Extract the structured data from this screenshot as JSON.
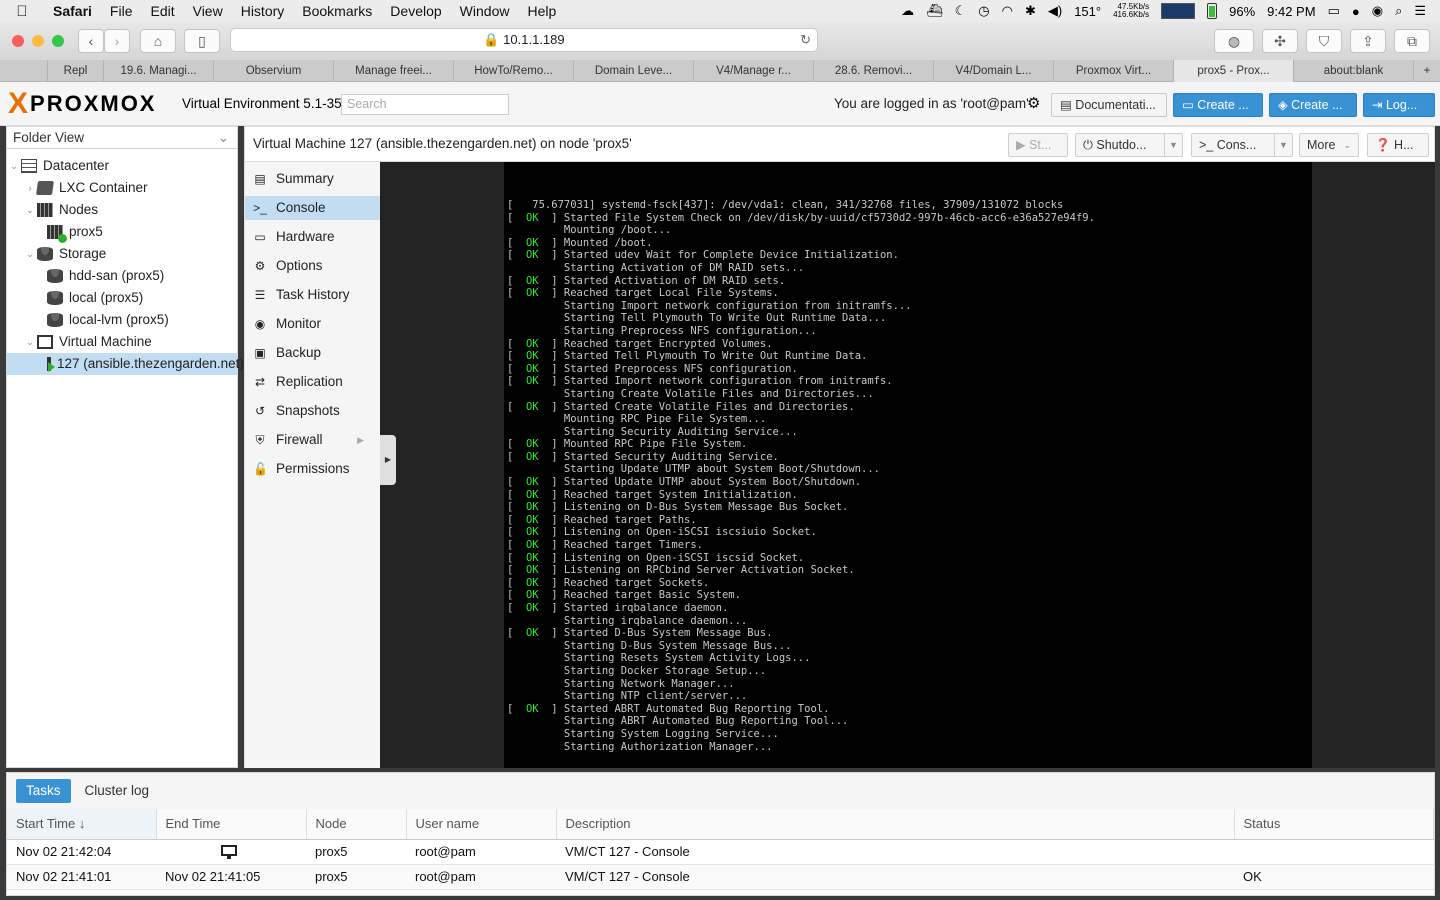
{
  "menubar": {
    "apple": "",
    "app_name": "Safari",
    "items": [
      "File",
      "Edit",
      "View",
      "History",
      "Bookmarks",
      "Develop",
      "Window",
      "Help"
    ],
    "temp": "151°",
    "net_up": "47.5Kb/s",
    "net_down": "416.6Kb/s",
    "battery": "96%",
    "clock": "9:42 PM"
  },
  "browser": {
    "url": "10.1.1.189",
    "tabs": [
      {
        "label": "Repl",
        "active": false
      },
      {
        "label": "19.6. Managi...",
        "active": false
      },
      {
        "label": "Observium",
        "active": false
      },
      {
        "label": "Manage freei...",
        "active": false
      },
      {
        "label": "HowTo/Remo...",
        "active": false
      },
      {
        "label": "Domain Leve...",
        "active": false
      },
      {
        "label": "V4/Manage r...",
        "active": false
      },
      {
        "label": "28.6. Removi...",
        "active": false
      },
      {
        "label": "V4/Domain L...",
        "active": false
      },
      {
        "label": "Proxmox Virt...",
        "active": false
      },
      {
        "label": "prox5 - Prox...",
        "active": true
      },
      {
        "label": "about:blank",
        "active": false
      }
    ],
    "new_tab": "+"
  },
  "pve": {
    "logo_x": "X",
    "logo_word": "PROXMOX",
    "version": "Virtual Environment 5.1-35",
    "search_placeholder": "Search",
    "logged_in": "You are logged in as 'root@pam'",
    "buttons": {
      "documentation": "Documentati...",
      "create_vm": "Create ...",
      "create_ct": "Create ...",
      "logout": "Log..."
    }
  },
  "tree": {
    "view_select": "Folder View",
    "nodes": [
      {
        "label": "Datacenter",
        "icon": "datacenter-icon"
      },
      {
        "label": "LXC Container",
        "icon": "container-icon"
      },
      {
        "label": "Nodes",
        "icon": "nodes-icon"
      },
      {
        "label": "prox5",
        "icon": "node-online-icon"
      },
      {
        "label": "Storage",
        "icon": "storage-icon"
      },
      {
        "label": "hdd-san (prox5)",
        "icon": "disk-icon"
      },
      {
        "label": "local (prox5)",
        "icon": "disk-icon"
      },
      {
        "label": "local-lvm (prox5)",
        "icon": "disk-icon"
      },
      {
        "label": "Virtual Machine",
        "icon": "vm-folder-icon"
      },
      {
        "label": "127 (ansible.thezengarden.net)",
        "icon": "vm-running-icon"
      }
    ]
  },
  "content": {
    "title": "Virtual Machine 127 (ansible.thezengarden.net) on node 'prox5'",
    "buttons": {
      "start": "St...",
      "shutdown": "Shutdo...",
      "console": "Cons...",
      "more": "More",
      "help": "H..."
    }
  },
  "vmnav": [
    {
      "label": "Summary",
      "icon": "summary-icon",
      "glyph": "▤"
    },
    {
      "label": "Console",
      "icon": "console-icon",
      "glyph": ">_"
    },
    {
      "label": "Hardware",
      "icon": "hardware-icon",
      "glyph": "▭"
    },
    {
      "label": "Options",
      "icon": "options-icon",
      "glyph": "⚙"
    },
    {
      "label": "Task History",
      "icon": "task-history-icon",
      "glyph": "☰"
    },
    {
      "label": "Monitor",
      "icon": "monitor-icon",
      "glyph": "◉"
    },
    {
      "label": "Backup",
      "icon": "backup-icon",
      "glyph": "▣"
    },
    {
      "label": "Replication",
      "icon": "replication-icon",
      "glyph": "⇄"
    },
    {
      "label": "Snapshots",
      "icon": "snapshots-icon",
      "glyph": "↺"
    },
    {
      "label": "Firewall",
      "icon": "firewall-icon",
      "glyph": "⛨"
    },
    {
      "label": "Permissions",
      "icon": "permissions-icon",
      "glyph": "🔓"
    }
  ],
  "console_lines": [
    {
      "ok": false,
      "text": "[   75.677031] systemd-fsck[437]: /dev/vda1: clean, 341/32768 files, 37909/131072 blocks"
    },
    {
      "ok": true,
      "text": "Started File System Check on /dev/disk/by-uuid/cf5730d2-997b-46cb-acc6-e36a527e94f9."
    },
    {
      "ok": false,
      "text": "         Mounting /boot..."
    },
    {
      "ok": true,
      "text": "Mounted /boot."
    },
    {
      "ok": true,
      "text": "Started udev Wait for Complete Device Initialization."
    },
    {
      "ok": false,
      "text": "         Starting Activation of DM RAID sets..."
    },
    {
      "ok": true,
      "text": "Started Activation of DM RAID sets."
    },
    {
      "ok": true,
      "text": "Reached target Local File Systems."
    },
    {
      "ok": false,
      "text": "         Starting Import network configuration from initramfs..."
    },
    {
      "ok": false,
      "text": "         Starting Tell Plymouth To Write Out Runtime Data..."
    },
    {
      "ok": false,
      "text": "         Starting Preprocess NFS configuration..."
    },
    {
      "ok": true,
      "text": "Reached target Encrypted Volumes."
    },
    {
      "ok": true,
      "text": "Started Tell Plymouth To Write Out Runtime Data."
    },
    {
      "ok": true,
      "text": "Started Preprocess NFS configuration."
    },
    {
      "ok": true,
      "text": "Started Import network configuration from initramfs."
    },
    {
      "ok": false,
      "text": "         Starting Create Volatile Files and Directories..."
    },
    {
      "ok": true,
      "text": "Started Create Volatile Files and Directories."
    },
    {
      "ok": false,
      "text": "         Mounting RPC Pipe File System..."
    },
    {
      "ok": false,
      "text": "         Starting Security Auditing Service..."
    },
    {
      "ok": true,
      "text": "Mounted RPC Pipe File System."
    },
    {
      "ok": true,
      "text": "Started Security Auditing Service."
    },
    {
      "ok": false,
      "text": "         Starting Update UTMP about System Boot/Shutdown..."
    },
    {
      "ok": true,
      "text": "Started Update UTMP about System Boot/Shutdown."
    },
    {
      "ok": true,
      "text": "Reached target System Initialization."
    },
    {
      "ok": true,
      "text": "Listening on D-Bus System Message Bus Socket."
    },
    {
      "ok": true,
      "text": "Reached target Paths."
    },
    {
      "ok": true,
      "text": "Listening on Open-iSCSI iscsiuio Socket."
    },
    {
      "ok": true,
      "text": "Reached target Timers."
    },
    {
      "ok": true,
      "text": "Listening on Open-iSCSI iscsid Socket."
    },
    {
      "ok": true,
      "text": "Listening on RPCbind Server Activation Socket."
    },
    {
      "ok": true,
      "text": "Reached target Sockets."
    },
    {
      "ok": true,
      "text": "Reached target Basic System."
    },
    {
      "ok": true,
      "text": "Started irqbalance daemon."
    },
    {
      "ok": false,
      "text": "         Starting irqbalance daemon..."
    },
    {
      "ok": true,
      "text": "Started D-Bus System Message Bus."
    },
    {
      "ok": false,
      "text": "         Starting D-Bus System Message Bus..."
    },
    {
      "ok": false,
      "text": "         Starting Resets System Activity Logs..."
    },
    {
      "ok": false,
      "text": "         Starting Docker Storage Setup..."
    },
    {
      "ok": false,
      "text": "         Starting Network Manager..."
    },
    {
      "ok": false,
      "text": "         Starting NTP client/server..."
    },
    {
      "ok": true,
      "text": "Started ABRT Automated Bug Reporting Tool."
    },
    {
      "ok": false,
      "text": "         Starting ABRT Automated Bug Reporting Tool..."
    },
    {
      "ok": false,
      "text": "         Starting System Logging Service..."
    },
    {
      "ok": false,
      "text": "         Starting Authorization Manager..."
    }
  ],
  "tasks": {
    "tabs": [
      "Tasks",
      "Cluster log"
    ],
    "columns": [
      "Start Time ↓",
      "End Time",
      "Node",
      "User name",
      "Description",
      "Status"
    ],
    "rows": [
      {
        "start": "Nov 02 21:42:04",
        "end": "",
        "end_icon": "monitor-icon",
        "node": "prox5",
        "user": "root@pam",
        "desc": "VM/CT 127 - Console",
        "status": ""
      },
      {
        "start": "Nov 02 21:41:01",
        "end": "Nov 02 21:41:05",
        "end_icon": "",
        "node": "prox5",
        "user": "root@pam",
        "desc": "VM/CT 127 - Console",
        "status": "OK"
      }
    ]
  },
  "colors": {
    "accent_blue": "#3892d4",
    "proxmox_orange": "#e57000",
    "selection": "#c2ddf2",
    "console_ok": "#2ee82e"
  }
}
